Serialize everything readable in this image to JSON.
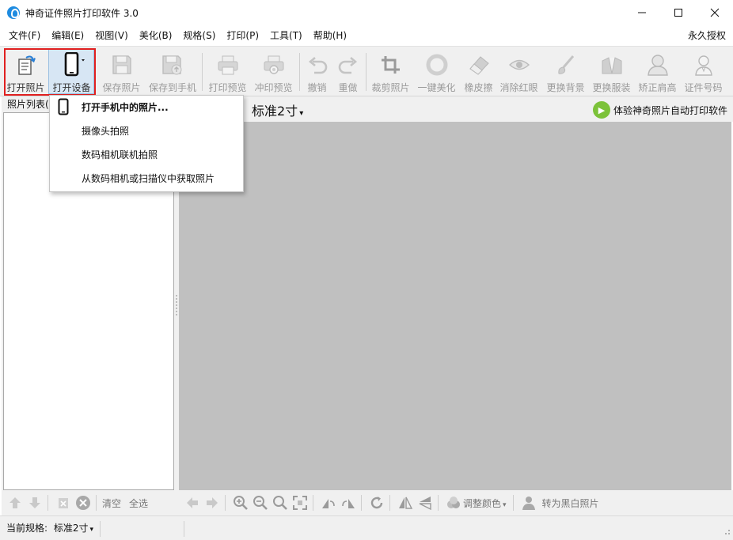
{
  "window": {
    "title": "神奇证件照片打印软件 3.0",
    "controls": {
      "minimize": "—",
      "maximize": "☐",
      "close": "✕"
    }
  },
  "menubar": {
    "items": [
      "文件(F)",
      "编辑(E)",
      "视图(V)",
      "美化(B)",
      "规格(S)",
      "打印(P)",
      "工具(T)",
      "帮助(H)"
    ],
    "license": "永久授权"
  },
  "toolbar": {
    "open_photo": "打开照片",
    "open_device": "打开设备",
    "save_photo": "保存照片",
    "save_to_phone": "保存到手机",
    "print_preview": "打印预览",
    "develop_preview": "冲印预览",
    "undo": "撤销",
    "redo": "重做",
    "crop": "裁剪照片",
    "one_click_beautify": "一键美化",
    "eraser": "橡皮擦",
    "remove_redeye": "消除红眼",
    "change_background": "更换背景",
    "change_clothes": "更换服装",
    "correct_shoulder": "矫正肩高",
    "id_number": "证件号码"
  },
  "left_panel": {
    "header": "照片列表(",
    "clear": "清空",
    "select_all": "全选"
  },
  "spec_bar": {
    "spec": "标准2寸",
    "promo": "体验神奇照片自动打印软件"
  },
  "bottom_toolbar": {
    "adjust_color": "调整颜色",
    "to_bw": "转为黑白照片"
  },
  "statusbar": {
    "current_spec_label": "当前规格:",
    "current_spec_value": "标准2寸"
  },
  "dropdown": {
    "items": [
      "打开手机中的照片...",
      "摄像头拍照",
      "数码相机联机拍照",
      "从数码相机或扫描仪中获取照片"
    ]
  }
}
